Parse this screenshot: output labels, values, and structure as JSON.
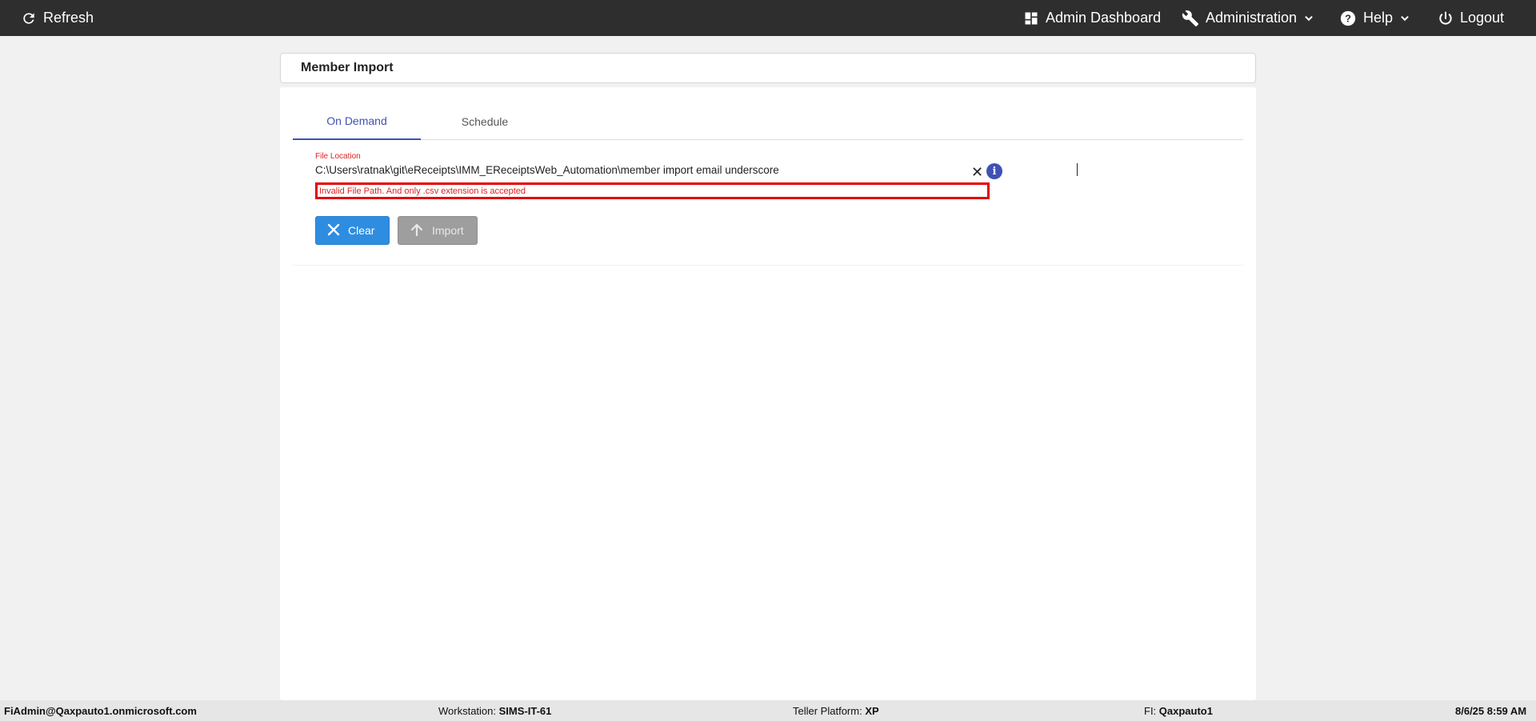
{
  "topbar": {
    "refresh_label": "Refresh",
    "admin_dashboard_label": "Admin Dashboard",
    "administration_label": "Administration",
    "help_label": "Help",
    "logout_label": "Logout"
  },
  "page": {
    "title": "Member Import"
  },
  "tabs": [
    {
      "label": "On Demand",
      "active": true
    },
    {
      "label": "Schedule",
      "active": false
    }
  ],
  "form": {
    "file_location_label": "File Location",
    "file_location_value": "C:\\Users\\ratnak\\git\\eReceipts\\IMM_EReceiptsWeb_Automation\\member import email underscore",
    "error_message": "Invalid File Path. And only .csv extension is accepted",
    "clear_label": "Clear",
    "import_label": "Import"
  },
  "statusbar": {
    "user": "FiAdmin@Qaxpauto1.onmicrosoft.com",
    "workstation_label": "Workstation:",
    "workstation_value": "SIMS-IT-61",
    "teller_platform_label": "Teller Platform:",
    "teller_platform_value": "XP",
    "fi_label": "FI:",
    "fi_value": "Qaxpauto1",
    "datetime": "8/6/25 8:59 AM"
  },
  "colors": {
    "topbar_bg": "#2e2e2e",
    "accent": "#3f51b5",
    "error": "#e30000",
    "clear_button": "#2e8de0",
    "import_button_disabled": "#9e9e9e"
  }
}
